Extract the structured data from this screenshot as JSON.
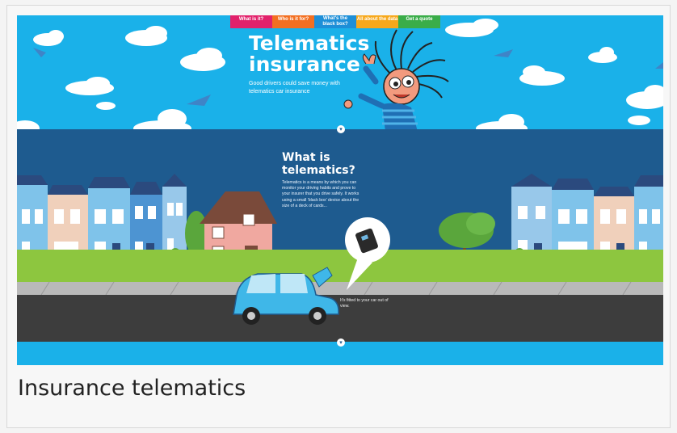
{
  "nav": {
    "items": [
      {
        "label": "What is it?",
        "color": "#e2216b"
      },
      {
        "label": "Who is it for?",
        "color": "#f36f21"
      },
      {
        "label": "What's the black box?",
        "color": "#1d8fd8"
      },
      {
        "label": "All about the data",
        "color": "#f7a81b"
      },
      {
        "label": "Get a quote",
        "color": "#3aad49"
      }
    ]
  },
  "hero": {
    "title": "Telematics insurance",
    "subtitle": "Good drivers could save money with telematics car insurance"
  },
  "section": {
    "title": "What is telematics?",
    "body": "Telematics is a means by which you can monitor your driving habits and prove to your insurer that you drive safely. It works using a small 'black box' device about the size of a deck of cards...",
    "road_text": "It's fitted to your car out of view."
  },
  "caption": "Insurance telematics",
  "colors": {
    "sky": "#1ab1e9",
    "band": "#1e5b8f",
    "grass": "#8dc63f",
    "road": "#3d3d3d",
    "car": "#3fb7e8"
  },
  "icons": [
    "chevron-down-icon",
    "black-box-icon"
  ]
}
